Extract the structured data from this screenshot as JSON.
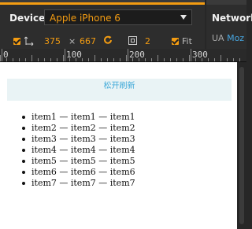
{
  "toolbar": {
    "device_label": "Device",
    "device_value": "Apple iPhone 6",
    "width": "375",
    "times": "×",
    "height": "667",
    "scale": "2",
    "fit_label": "Fit",
    "network_label": "Network",
    "ua_label": "UA",
    "ua_value": "Moz"
  },
  "ruler": {
    "labels": [
      "0",
      "100",
      "200",
      "300"
    ]
  },
  "page": {
    "refresh_text": "松开刷新",
    "items": [
      "item1 — item1 — item1",
      "item2 — item2 — item2",
      "item3 — item3 — item3",
      "item4 — item4 — item4",
      "item5 — item5 — item5",
      "item6 — item6 — item6",
      "item7 — item7 — item7"
    ]
  },
  "colors": {
    "accent": "#f39c12",
    "link_blue": "#3fa9d9",
    "ua_blue": "#47a6e0",
    "panel_bg": "#2d2d2d"
  }
}
